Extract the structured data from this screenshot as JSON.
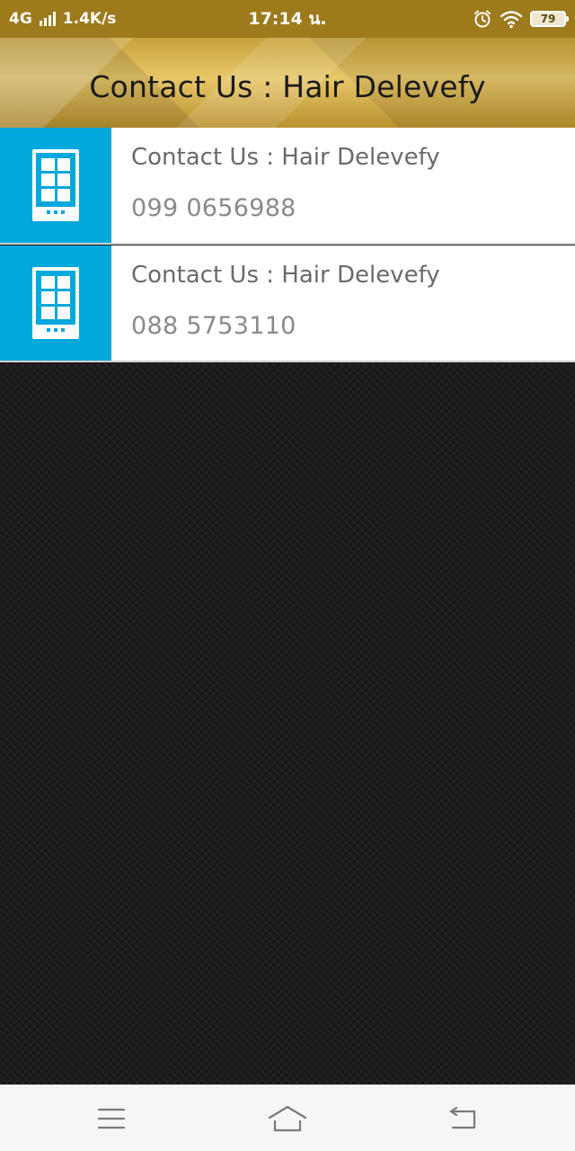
{
  "status_bar": {
    "network": "4G",
    "speed": "1.4K/s",
    "time": "17:14 น.",
    "battery": "79",
    "icons": [
      "signal-icon",
      "alarm-icon",
      "wifi-icon",
      "battery-icon"
    ]
  },
  "header": {
    "title": "Contact Us : Hair Delevefy"
  },
  "contacts": [
    {
      "name": "Contact Us : Hair Delevefy",
      "phone": "099 0656988",
      "icon": "phone-icon"
    },
    {
      "name": "Contact Us : Hair Delevefy",
      "phone": "088 5753110",
      "icon": "phone-icon"
    }
  ],
  "nav": {
    "buttons": [
      "menu-icon",
      "home-icon",
      "back-icon"
    ]
  },
  "colors": {
    "header_gold": "#c7a13a",
    "icon_blue": "#00a8dc",
    "background": "#1c1c1c"
  }
}
